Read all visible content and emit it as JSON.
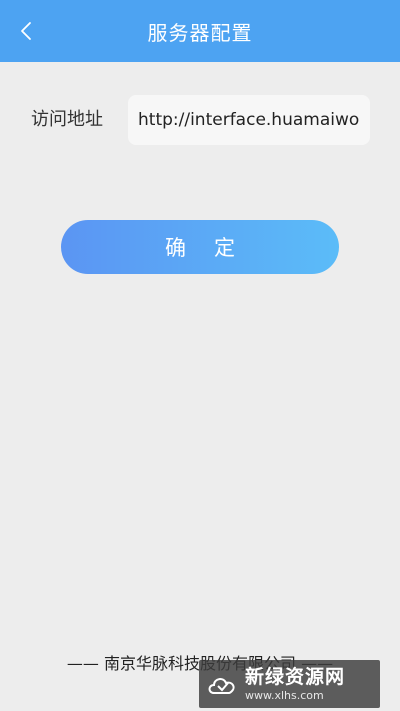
{
  "header": {
    "title": "服务器配置",
    "back_icon": "chevron-left-icon"
  },
  "form": {
    "address_label": "访问地址",
    "address_value": "http://interface.huamaiwo"
  },
  "confirm_label": "确定",
  "footer": {
    "company": "—— 南京华脉科技股份有限公司 ——"
  },
  "watermark": {
    "name": "新绿资源网",
    "url": "www.xlhs.com",
    "logo_icon": "cloud-logo-icon"
  },
  "colors": {
    "header": "#4da3f2",
    "button_start": "#5b95f3",
    "button_end": "#5bbcf8",
    "background": "#ededed"
  }
}
